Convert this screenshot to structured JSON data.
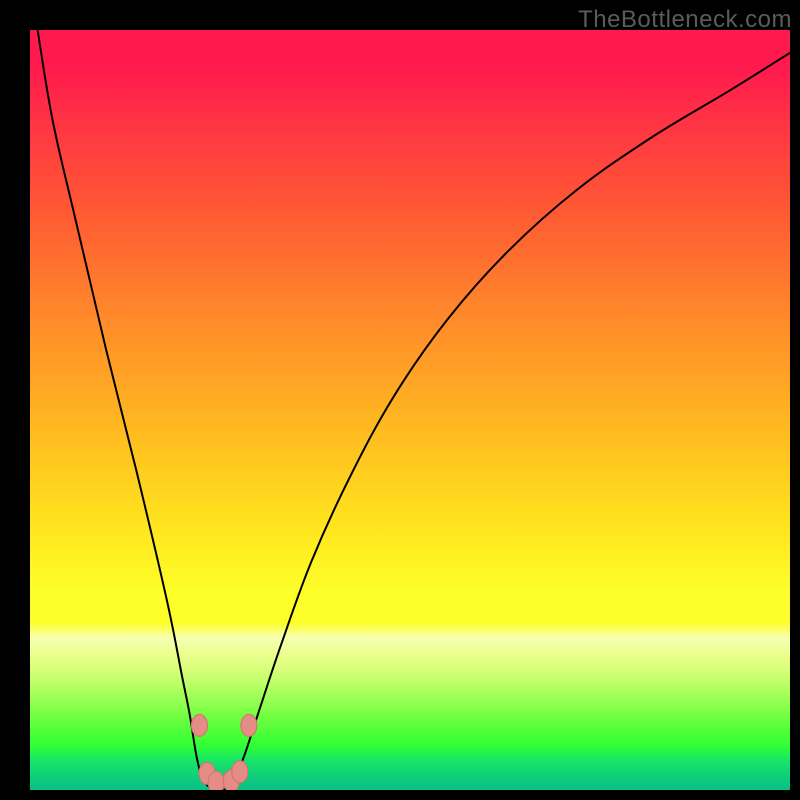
{
  "watermark": "TheBottleneck.com",
  "colors": {
    "frame": "#000000",
    "curve": "#000000",
    "dot_fill": "#e58c86",
    "dot_stroke": "#d57770"
  },
  "chart_data": {
    "type": "line",
    "title": "",
    "xlabel": "",
    "ylabel": "",
    "xlim": [
      0,
      100
    ],
    "ylim": [
      0,
      100
    ],
    "series": [
      {
        "name": "bottleneck-curve",
        "x": [
          1,
          3,
          6,
          10,
          14,
          18,
          20,
          21,
          22,
          23,
          24.5,
          25.5,
          26.5,
          28,
          30,
          33,
          37,
          42,
          48,
          55,
          63,
          72,
          82,
          92,
          100
        ],
        "values": [
          100,
          88,
          75,
          58,
          42,
          25,
          15,
          10,
          4,
          1,
          0,
          0,
          1,
          4,
          10,
          19,
          30,
          41,
          52,
          62,
          71,
          79,
          86,
          92,
          97
        ]
      }
    ],
    "annotations": [
      {
        "name": "fit-dot-left-upper",
        "x": 22.3,
        "y": 8.5
      },
      {
        "name": "fit-dot-left-lower",
        "x": 23.3,
        "y": 2.2
      },
      {
        "name": "fit-dot-mid-left",
        "x": 24.5,
        "y": 1.0
      },
      {
        "name": "fit-dot-mid-right",
        "x": 26.5,
        "y": 1.2
      },
      {
        "name": "fit-dot-right-lower",
        "x": 27.6,
        "y": 2.4
      },
      {
        "name": "fit-dot-right-upper",
        "x": 28.8,
        "y": 8.5
      }
    ]
  }
}
